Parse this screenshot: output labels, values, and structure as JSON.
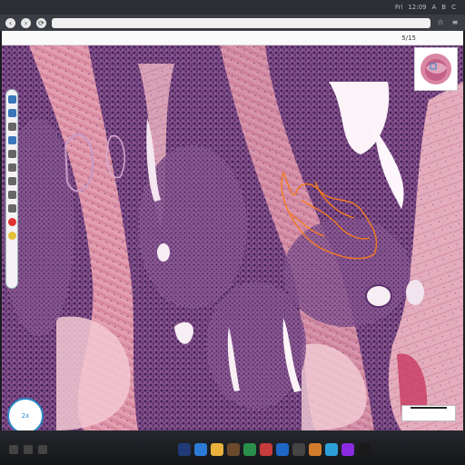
{
  "os_bar": {
    "items": [
      "Fri",
      "12:09",
      "A",
      "B",
      "C"
    ]
  },
  "browser": {
    "address": "",
    "nav": [
      "‹",
      "›",
      "⟳"
    ]
  },
  "viewer": {
    "header_left": "",
    "header_center": "",
    "header_right": "5/15",
    "zoom_label": "2x",
    "scale_label": ""
  },
  "toolbar": {
    "tools": [
      "pointer",
      "pen",
      "ruler",
      "circle",
      "square",
      "text",
      "arrow",
      "pan",
      "zoom",
      "color-red",
      "color-yellow"
    ]
  },
  "taskbar": {
    "dock_colors": [
      "#1f3a76",
      "#2d7bd6",
      "#e8b23c",
      "#6a4a2a",
      "#2a8f4a",
      "#c63b3b",
      "#1d66c6",
      "#444",
      "#d27d2c",
      "#2c9fd8",
      "#8a2be2",
      "#1a1a1a"
    ]
  },
  "colors": {
    "accent": "#2f87c8",
    "tissue_pink": "#e29aa8",
    "tissue_purple": "#5f356f",
    "annotation": "#f47b20"
  }
}
